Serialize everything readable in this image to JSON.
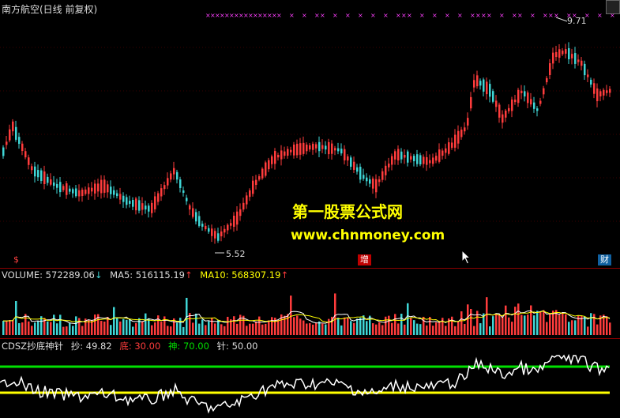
{
  "header": {
    "title": "南方航空(日线 前复权)",
    "high_label": "9.71",
    "low_label": "5.52"
  },
  "markers": {
    "left": "$",
    "middle": "增",
    "right": "财"
  },
  "watermark": {
    "line1": "第一股票公式网",
    "line2": "www.chnmoney.com"
  },
  "volume_legend": {
    "volume": "VOLUME: 572289.06",
    "ma5": "MA5: 516115.19",
    "ma10": "MA10: 568307.19"
  },
  "indicator_legend": {
    "name": "CDSZ抄底神针",
    "chao": "抄: 49.82",
    "di": "底: 30.00",
    "shen": "神: 70.00",
    "zhen": "针: 50.00"
  },
  "colors": {
    "up": "#ff3c3c",
    "down": "#3fd6d6",
    "green_line": "#00e000",
    "yellow_line": "#ffff00",
    "white_line": "#ffffff",
    "magenta": "#ff40ff",
    "sep": "#8b0000"
  },
  "icons": {
    "arrow_up": "↑",
    "arrow_down": "↓",
    "cursor": "mouse-cursor-icon"
  }
}
